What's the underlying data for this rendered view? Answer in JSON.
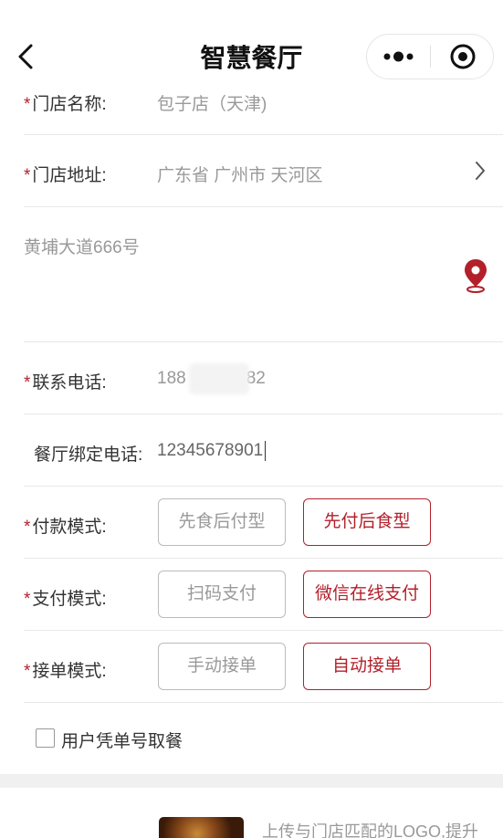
{
  "navbar": {
    "title": "智慧餐厅"
  },
  "form": {
    "required_mark": "*",
    "store_name": {
      "label": "门店名称:",
      "value": "包子店（天津)"
    },
    "store_address": {
      "label": "门店地址:",
      "value": "广东省 广州市 天河区"
    },
    "address_detail": {
      "value": "黄埔大道666号"
    },
    "contact_phone": {
      "label": "联系电话:",
      "value_prefix": "188",
      "value_suffix": "82"
    },
    "bound_phone": {
      "label": "餐厅绑定电话:",
      "value": "12345678901"
    },
    "payment_mode": {
      "label": "付款模式:",
      "options": [
        "先食后付型",
        "先付后食型"
      ],
      "selected": "先付后食型"
    },
    "pay_method": {
      "label": "支付模式:",
      "options": [
        "扫码支付",
        "微信在线支付"
      ],
      "selected": "微信在线支付"
    },
    "order_mode": {
      "label": "接单模式:",
      "options": [
        "手动接单",
        "自动接单"
      ],
      "selected": "自动接单"
    },
    "voucher_pickup": {
      "label": "用户凭单号取餐",
      "checked": false
    }
  },
  "logo_section": {
    "hint": "上传与门店匹配的LOGO,提升"
  },
  "colors": {
    "accent": "#b3202a",
    "border": "#e8e8e8",
    "muted_text": "#999999"
  },
  "icons": {
    "back": "chevron-left-icon",
    "more": "more-dots-icon",
    "close": "target-circle-icon",
    "chevron": "chevron-right-icon",
    "location": "location-pin-icon"
  }
}
